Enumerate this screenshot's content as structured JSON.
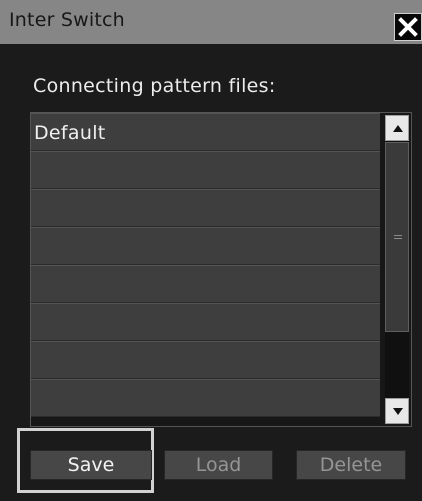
{
  "window": {
    "title": "Inter Switch"
  },
  "content": {
    "label": "Connecting pattern files:",
    "rows": [
      "Default",
      "",
      "",
      "",
      "",
      "",
      "",
      ""
    ]
  },
  "buttons": {
    "save": "Save",
    "load": "Load",
    "delete": "Delete"
  },
  "icons": {
    "close": "close-icon",
    "scroll_up": "scroll-up-icon",
    "scroll_down": "scroll-down-icon"
  }
}
